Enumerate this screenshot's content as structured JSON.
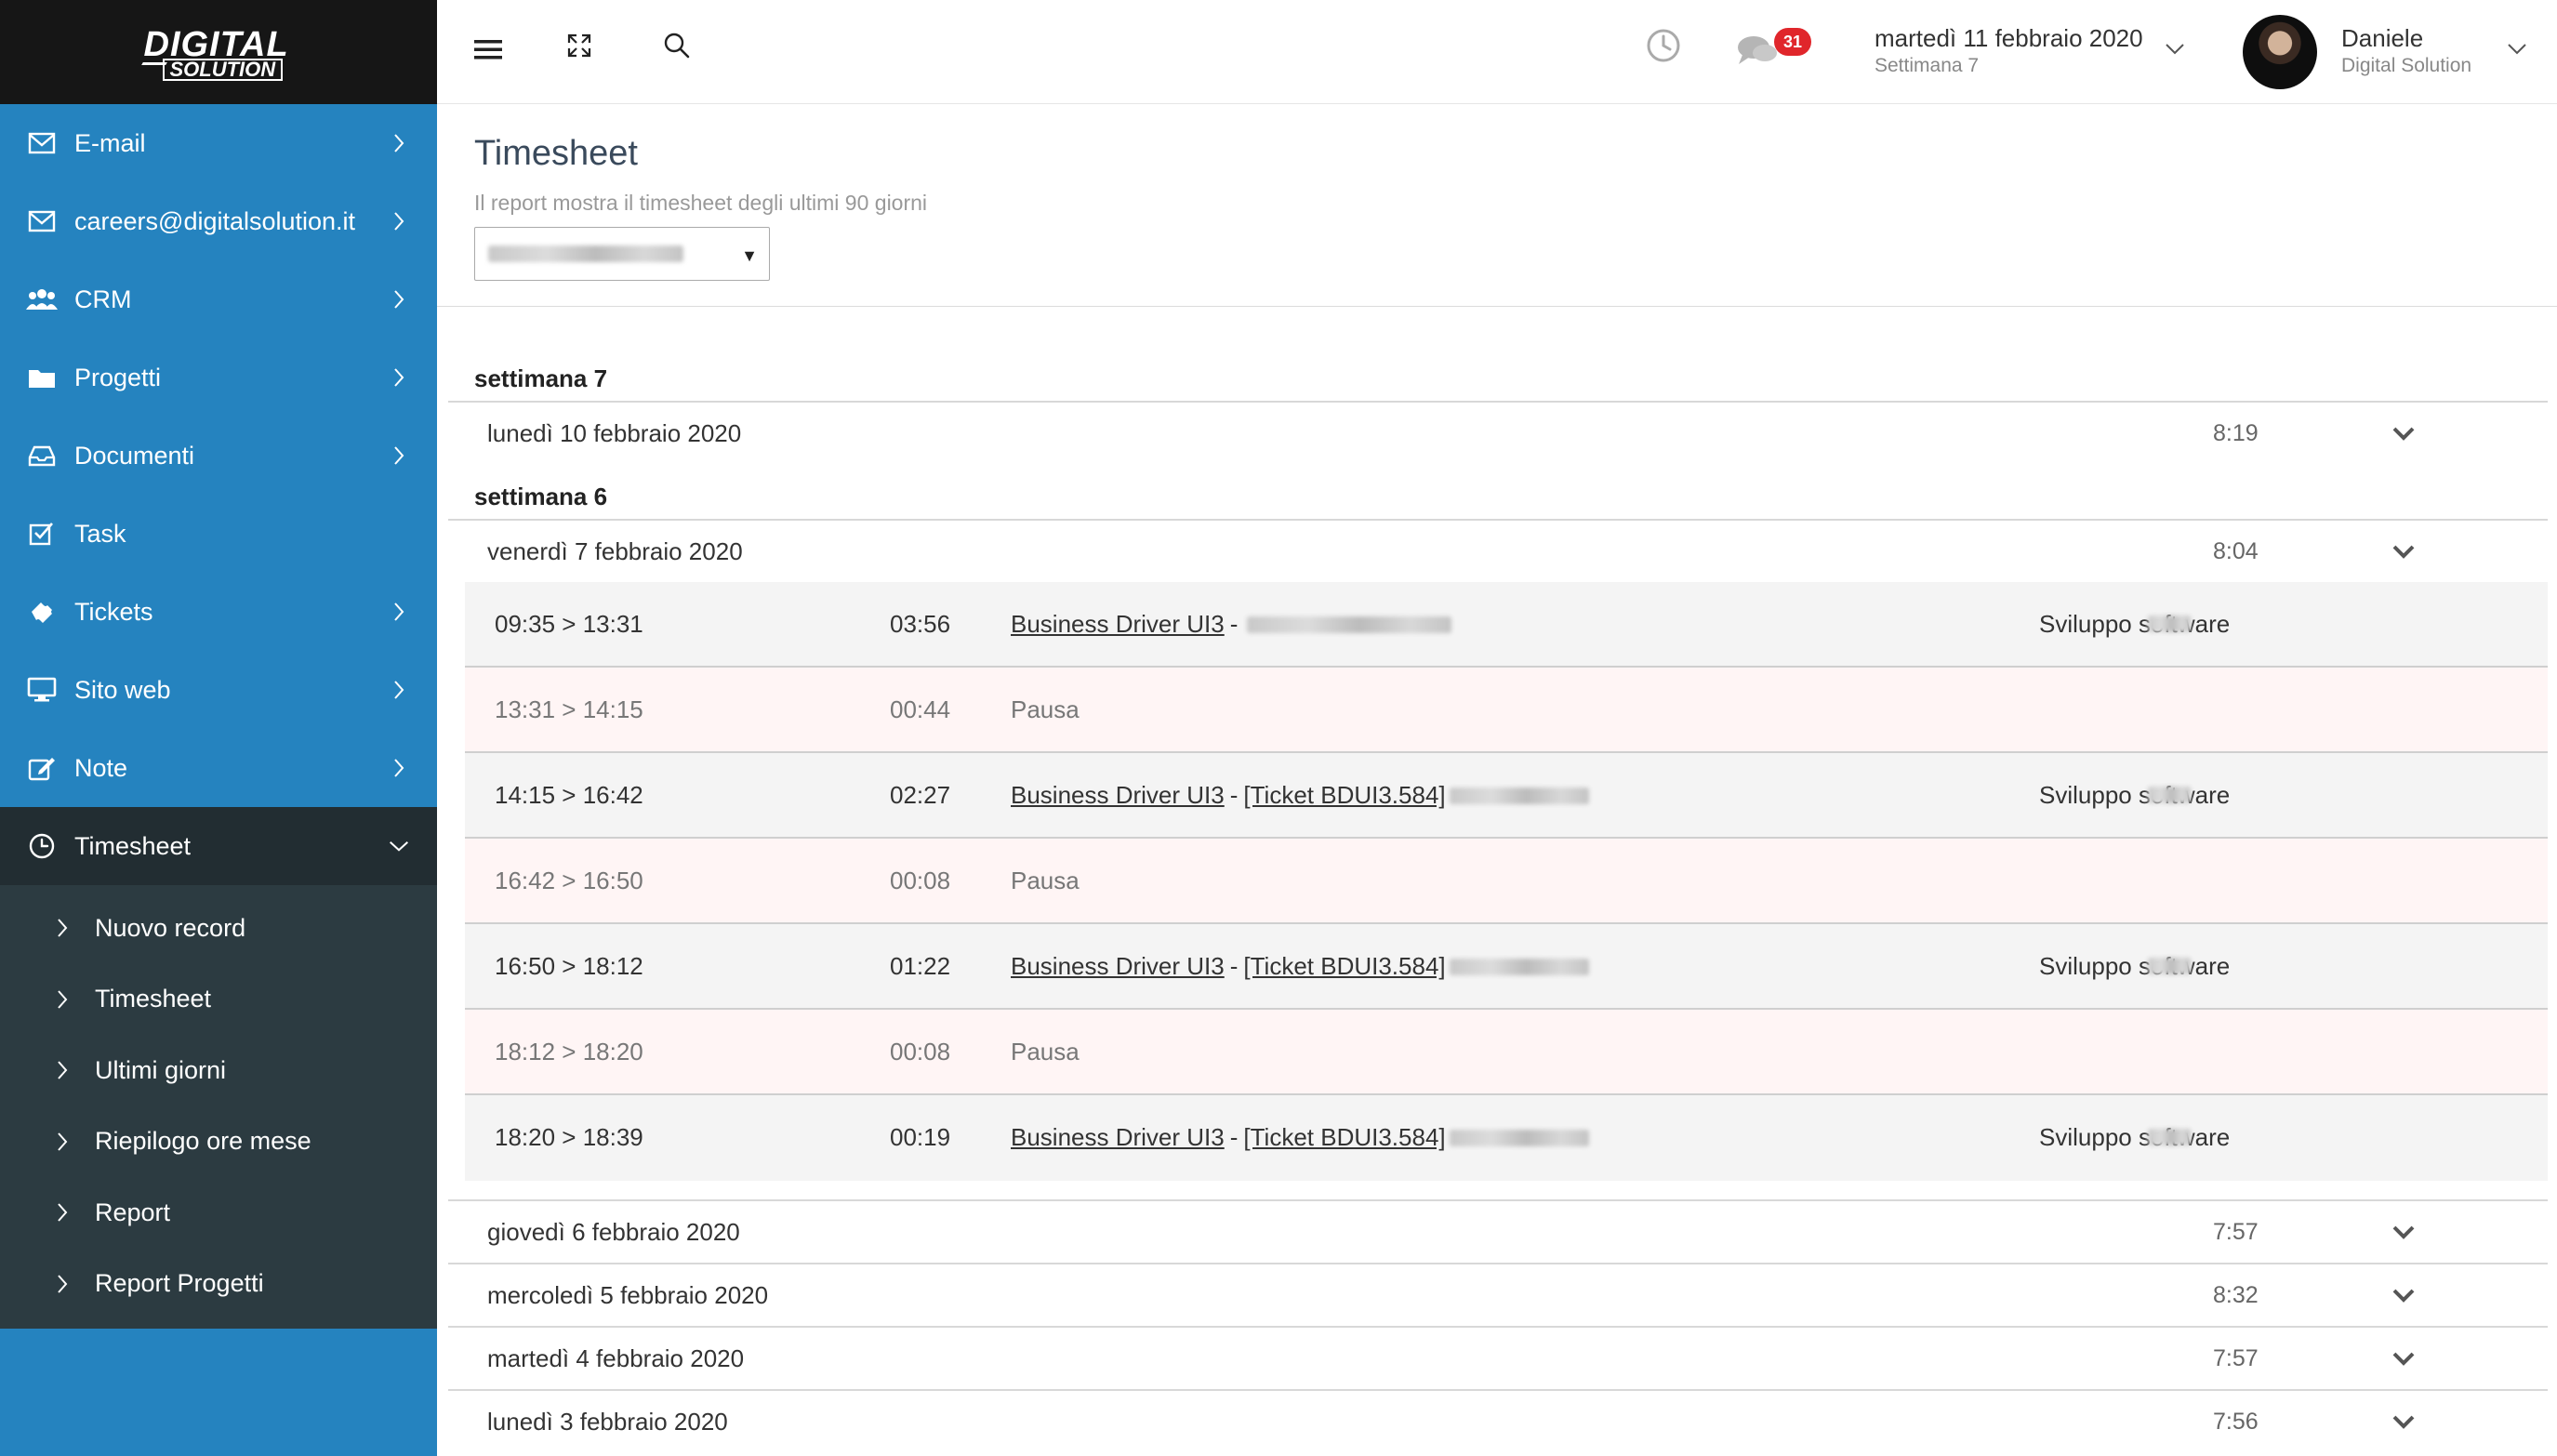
{
  "brand": {
    "line1": "DIGITAL",
    "line2": "SOLUTION"
  },
  "sidebar": {
    "items": [
      {
        "label": "E-mail",
        "icon": "envelope-icon",
        "has_children": true
      },
      {
        "label": "careers@digitalsolution.it",
        "icon": "envelope-icon",
        "has_children": true
      },
      {
        "label": "CRM",
        "icon": "users-icon",
        "has_children": true
      },
      {
        "label": "Progetti",
        "icon": "folder-icon",
        "has_children": true
      },
      {
        "label": "Documenti",
        "icon": "inbox-icon",
        "has_children": true
      },
      {
        "label": "Task",
        "icon": "checkbox-icon",
        "has_children": false
      },
      {
        "label": "Tickets",
        "icon": "ticket-icon",
        "has_children": true
      },
      {
        "label": "Sito web",
        "icon": "monitor-icon",
        "has_children": true
      },
      {
        "label": "Note",
        "icon": "edit-icon",
        "has_children": true
      }
    ],
    "active": {
      "label": "Timesheet",
      "icon": "clock-icon"
    },
    "submenu": [
      "Nuovo record",
      "Timesheet",
      "Ultimi giorni",
      "Riepilogo ore mese",
      "Report",
      "Report Progetti"
    ]
  },
  "topbar": {
    "notifications_count": "31",
    "date": "martedì 11 febbraio 2020",
    "week": "Settimana 7",
    "user_name": "Daniele",
    "user_company": "Digital Solution"
  },
  "page": {
    "title": "Timesheet",
    "subtitle": "Il report mostra il timesheet degli ultimi 90 giorni"
  },
  "weeks": [
    {
      "label": "settimana 7",
      "days": [
        {
          "date": "lunedì 10 febbraio 2020",
          "total": "8:19"
        }
      ]
    },
    {
      "label": "settimana 6",
      "days": [
        {
          "date": "venerdì 7 febbraio 2020",
          "total": "8:04",
          "entries": [
            {
              "type": "work",
              "time": "09:35 > 13:31",
              "duration": "03:56",
              "project": "Business Driver UI3",
              "sep": "-",
              "ticket": "",
              "category": "Sviluppo software"
            },
            {
              "type": "pause",
              "time": "13:31 > 14:15",
              "duration": "00:44",
              "label": "Pausa"
            },
            {
              "type": "work",
              "time": "14:15 > 16:42",
              "duration": "02:27",
              "project": "Business Driver UI3",
              "sep": "-",
              "ticket": "[Ticket BDUI3.584]",
              "category": "Sviluppo software"
            },
            {
              "type": "pause",
              "time": "16:42 > 16:50",
              "duration": "00:08",
              "label": "Pausa"
            },
            {
              "type": "work",
              "time": "16:50 > 18:12",
              "duration": "01:22",
              "project": "Business Driver UI3",
              "sep": "-",
              "ticket": "[Ticket BDUI3.584]",
              "category": "Sviluppo software"
            },
            {
              "type": "pause",
              "time": "18:12 > 18:20",
              "duration": "00:08",
              "label": "Pausa"
            },
            {
              "type": "work",
              "time": "18:20 > 18:39",
              "duration": "00:19",
              "project": "Business Driver UI3",
              "sep": "-",
              "ticket": "[Ticket BDUI3.584]",
              "category": "Sviluppo software"
            }
          ]
        },
        {
          "date": "giovedì 6 febbraio 2020",
          "total": "7:57"
        },
        {
          "date": "mercoledì 5 febbraio 2020",
          "total": "8:32"
        },
        {
          "date": "martedì 4 febbraio 2020",
          "total": "7:57"
        },
        {
          "date": "lunedì 3 febbraio 2020",
          "total": "7:56"
        }
      ]
    }
  ]
}
